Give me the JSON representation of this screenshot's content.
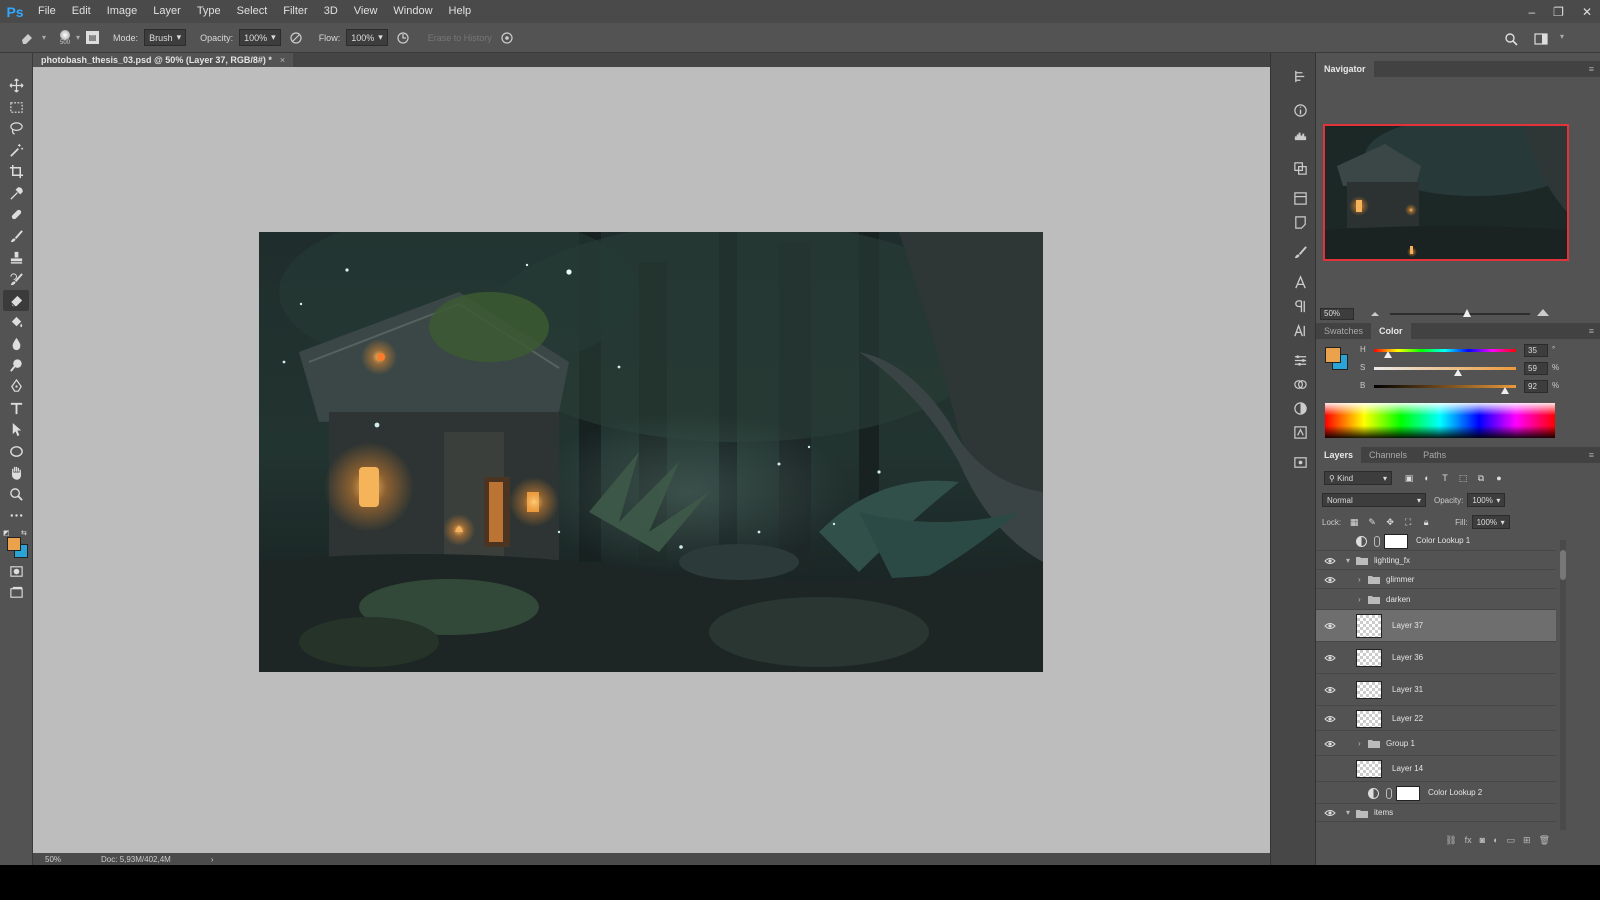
{
  "app": {
    "logo": "Ps"
  },
  "menu": [
    "File",
    "Edit",
    "Image",
    "Layer",
    "Type",
    "Select",
    "Filter",
    "3D",
    "View",
    "Window",
    "Help"
  ],
  "window_controls": {
    "minimize": "–",
    "restore": "❐",
    "close": "✕"
  },
  "options": {
    "brush_size": "500",
    "mode_label": "Mode:",
    "mode_value": "Brush",
    "opacity_label": "Opacity:",
    "opacity_value": "100%",
    "flow_label": "Flow:",
    "flow_value": "100%",
    "erase_history": "Erase to History"
  },
  "document": {
    "tab_title": "photobash_thesis_03.psd @ 50% (Layer 37, RGB/8#) *",
    "close": "×"
  },
  "status": {
    "zoom": "50%",
    "doc": "Doc: 5,93M/402,4M",
    "arrow": "›"
  },
  "colors": {
    "foreground": "#eaa24d",
    "background": "#2aa3d6",
    "nav_border": "#e3323a"
  },
  "panels": {
    "navigator": {
      "tab": "Navigator",
      "zoom": "50%",
      "zoom_fraction": 0.55
    },
    "color": {
      "tabs": [
        "Swatches",
        "Color"
      ],
      "h_label": "H",
      "h_value": "35",
      "h_unit": "°",
      "s_label": "S",
      "s_value": "59",
      "s_unit": "%",
      "b_label": "B",
      "b_value": "92",
      "b_unit": "%"
    },
    "layers": {
      "tabs": [
        "Layers",
        "Channels",
        "Paths"
      ],
      "filter_kind": "Kind",
      "blend_mode": "Normal",
      "opacity_label": "Opacity:",
      "opacity_value": "100%",
      "lock_label": "Lock:",
      "fill_label": "Fill:",
      "fill_value": "100%",
      "items": [
        {
          "name": "Color Lookup 1",
          "visible": false,
          "type": "adjustment"
        },
        {
          "name": "lighting_fx",
          "visible": true,
          "type": "group-open"
        },
        {
          "name": "glimmer",
          "visible": true,
          "type": "group"
        },
        {
          "name": "darken",
          "visible": false,
          "type": "group"
        },
        {
          "name": "Layer 37",
          "visible": true,
          "type": "pixel",
          "selected": true
        },
        {
          "name": "Layer 36",
          "visible": true,
          "type": "pixel"
        },
        {
          "name": "Layer 31",
          "visible": true,
          "type": "pixel"
        },
        {
          "name": "Layer 22",
          "visible": true,
          "type": "pixel"
        },
        {
          "name": "Group 1",
          "visible": true,
          "type": "group"
        },
        {
          "name": "Layer 14",
          "visible": false,
          "type": "pixel"
        },
        {
          "name": "Color Lookup 2",
          "visible": false,
          "type": "adjustment"
        },
        {
          "name": "items",
          "visible": true,
          "type": "group-open"
        }
      ]
    }
  }
}
